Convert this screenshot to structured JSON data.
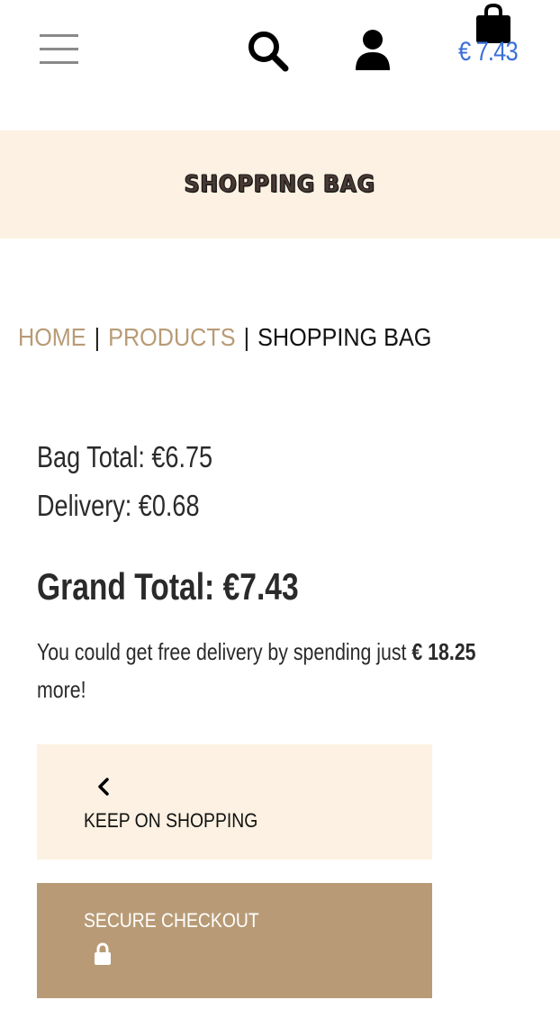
{
  "header": {
    "bag_total": "€ 7.43",
    "icons": {
      "menu": "hamburger-icon",
      "search": "search-icon",
      "account": "user-icon",
      "bag": "shopping-bag-icon"
    },
    "accent_color": "#3a6fd8"
  },
  "banner": {
    "title": "SHOPPING BAG",
    "background": "#fcf1e2"
  },
  "breadcrumb": {
    "items": [
      "HOME",
      "PRODUCTS",
      "SHOPPING BAG"
    ],
    "separator": "|",
    "link_color": "#b89b76"
  },
  "summary": {
    "bag_total": "Bag Total: €6.75",
    "delivery": "Delivery: €0.68",
    "grand_total": "Grand Total: €7.43",
    "free_delivery_prefix": "You could get free delivery by spending just ",
    "free_delivery_amount": "€ 18.25",
    "free_delivery_suffix": "more!"
  },
  "actions": {
    "keep_shopping_label": "KEEP ON SHOPPING",
    "checkout_label": "SECURE CHECKOUT",
    "checkout_color": "#b89b76"
  }
}
